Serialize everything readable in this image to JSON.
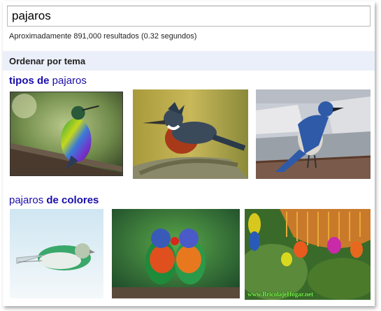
{
  "search": {
    "query": "pajaros"
  },
  "stats": {
    "text": "Aproximadamente 891,000 resultados (0.32 segundos)"
  },
  "sort": {
    "label": "Ordenar por tema"
  },
  "sections": [
    {
      "bold": "tipos de",
      "rest": " pajaros"
    },
    {
      "plain": "pajaros ",
      "bold": "de colores"
    }
  ],
  "watermark": "www.BricolajeHogar.net",
  "colors": {
    "link": "#1a0dab",
    "sort_bar_bg": "#ebeff9"
  }
}
